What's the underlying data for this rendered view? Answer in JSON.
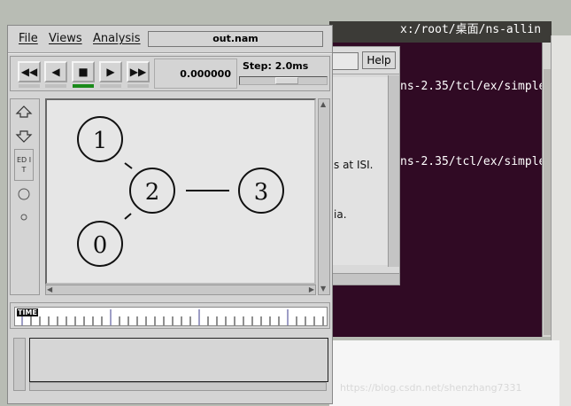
{
  "background": {
    "terminal": {
      "lines": [
        "x:/root/桌面/ns-allin",
        "ns-2.35/tcl/ex/simple",
        "ns-2.35/tcl/ex/simple"
      ]
    },
    "about_window": {
      "help_label": "Help",
      "text_line1": "s at ISI.",
      "text_line2": "ia."
    },
    "watermark": "https://blog.csdn.net/shenzhang7331"
  },
  "nam": {
    "menu": {
      "file": "File",
      "views": "Views",
      "analysis": "Analysis"
    },
    "filename": "out.nam",
    "controls": {
      "rewind": "◀◀",
      "back": "◀",
      "stop": "■",
      "play": "▶",
      "fast_forward": "▶▶",
      "active_indicator_color": "#1a8a1a"
    },
    "time_value": "0.000000",
    "step_label": "Step: 2.0ms",
    "step_slider_level": 0.55,
    "tools": {
      "zoom_in": "zoom-in-icon",
      "zoom_out": "zoom-out-icon",
      "edit_label": "ED IT"
    },
    "timeline_label": "TIME",
    "topology": {
      "nodes": [
        {
          "id": "1",
          "label": "1"
        },
        {
          "id": "2",
          "label": "2"
        },
        {
          "id": "3",
          "label": "3"
        },
        {
          "id": "0",
          "label": "0"
        }
      ]
    }
  }
}
